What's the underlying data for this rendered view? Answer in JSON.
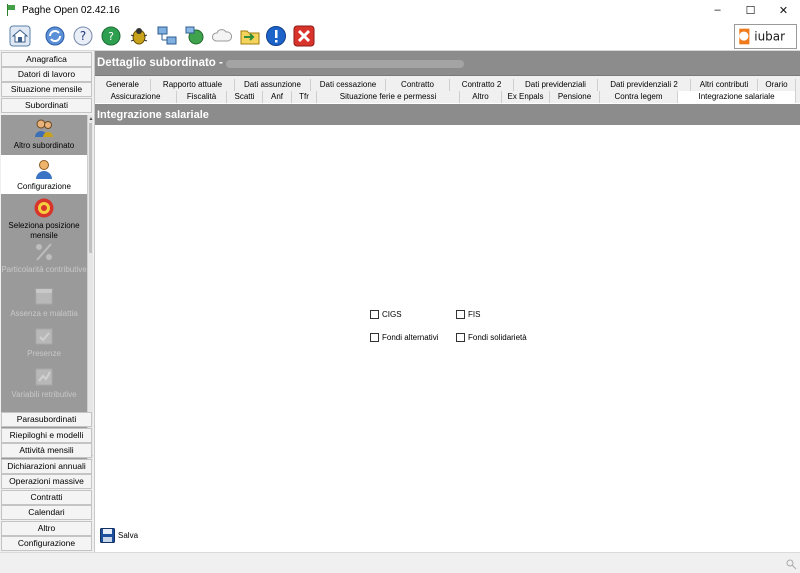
{
  "window": {
    "title": "Paghe Open 02.42.16",
    "minimize": "–",
    "maximize": "☐",
    "close": "✕"
  },
  "toolbar": {
    "icons": [
      "home-icon",
      "refresh-icon",
      "help-icon",
      "support-globe-icon",
      "bug-icon",
      "network-icon",
      "globe-network-icon",
      "cloud-icon",
      "folder-icon",
      "info-icon",
      "close-icon"
    ],
    "logo_text": "iubar"
  },
  "sidebar": {
    "top_items": [
      "Anagrafica",
      "Datori di lavoro",
      "Situazione mensile",
      "Subordinati"
    ],
    "panel_items": [
      {
        "label": "Altro subordinato",
        "icon": "users-icon"
      },
      {
        "label": "Configurazione",
        "icon": "user-settings-icon"
      },
      {
        "label": "Seleziona posizione mensile",
        "icon": "target-icon"
      },
      {
        "label": "Particolarità contributive",
        "icon": "percent-icon"
      },
      {
        "label": "Assenza e malattia",
        "icon": "calendar-icon"
      },
      {
        "label": "Presenze",
        "icon": "presence-icon"
      },
      {
        "label": "Variabili retributive",
        "icon": "variables-icon"
      }
    ],
    "bottom_items": [
      "Parasubordinati",
      "Riepiloghi e modelli",
      "Attività mensili",
      "Dichiarazioni annuali",
      "Operazioni massive",
      "Contratti",
      "Calendari",
      "Altro",
      "Configurazione"
    ]
  },
  "main": {
    "title": "Dettaglio subordinato -",
    "tabs_row1": [
      "Generale",
      "Rapporto attuale",
      "Dati assunzione",
      "Dati cessazione",
      "Contratto",
      "Contratto 2",
      "Dati previdenziali",
      "Dati previdenziali 2",
      "Altri contributi",
      "Orario"
    ],
    "tabs_row2": [
      "Assicurazione",
      "Fiscalità",
      "Scatti",
      "Anf",
      "Tfr",
      "Situazione ferie e permessi",
      "Altro",
      "Ex Enpals",
      "Pensione",
      "Contra legem",
      "Integrazione salariale"
    ],
    "active_tab": "Integrazione salariale",
    "section_title": "Integrazione salariale",
    "checkboxes": {
      "cigs": "CIGS",
      "fis": "FIS",
      "fondi_alternativi": "Fondi alternativi",
      "fondi_solidarieta": "Fondi solidarietà"
    },
    "save_label": "Salva"
  }
}
